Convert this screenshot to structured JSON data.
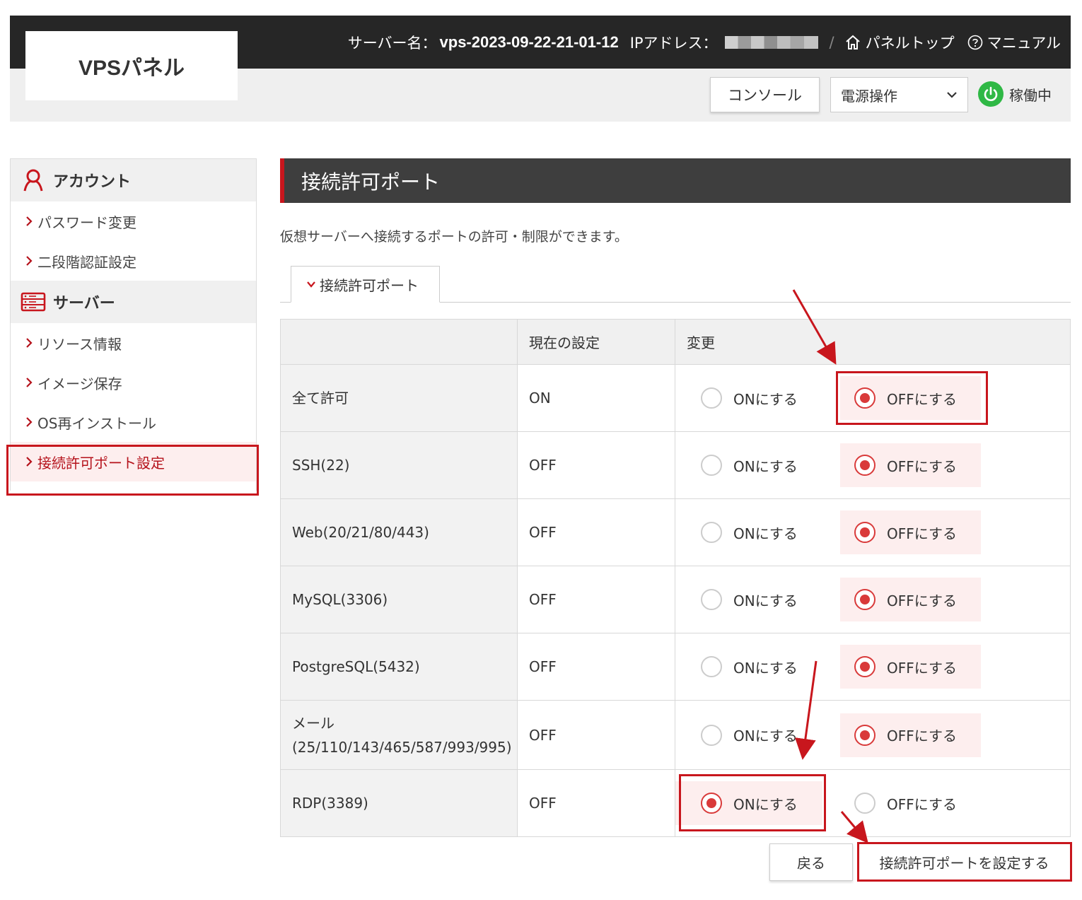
{
  "header": {
    "logo": "VPSパネル",
    "server_label": "サーバー名：",
    "server_name": "vps-2023-09-22-21-01-12",
    "ip_label": "IPアドレス：",
    "separator": "/",
    "panel_top": "パネルトップ",
    "manual": "マニュアル",
    "console_button": "コンソール",
    "power_select": "電源操作",
    "status": "稼働中"
  },
  "sidebar": {
    "account_heading": "アカウント",
    "account_items": [
      "パスワード変更",
      "二段階認証設定"
    ],
    "server_heading": "サーバー",
    "server_items": [
      "リソース情報",
      "イメージ保存",
      "OS再インストール",
      "接続許可ポート設定"
    ]
  },
  "main": {
    "title": "接続許可ポート",
    "description": "仮想サーバーへ接続するポートの許可・制限ができます。",
    "tab": "接続許可ポート",
    "table": {
      "headers": [
        "",
        "現在の設定",
        "変更"
      ],
      "on_label": "ONにする",
      "off_label": "OFFにする",
      "rows": [
        {
          "name": "全て許可",
          "current": "ON",
          "selected": "off"
        },
        {
          "name": "SSH(22)",
          "current": "OFF",
          "selected": "off"
        },
        {
          "name": "Web(20/21/80/443)",
          "current": "OFF",
          "selected": "off"
        },
        {
          "name": "MySQL(3306)",
          "current": "OFF",
          "selected": "off"
        },
        {
          "name": "PostgreSQL(5432)",
          "current": "OFF",
          "selected": "off"
        },
        {
          "name": "メール\n(25/110/143/465/587/993/995)",
          "current": "OFF",
          "selected": "off"
        },
        {
          "name": "RDP(3389)",
          "current": "OFF",
          "selected": "on"
        }
      ]
    },
    "back_button": "戻る",
    "submit_button": "接続許可ポートを設定する"
  },
  "colors": {
    "accent_red": "#c8161d",
    "header_dark": "#262626",
    "status_green": "#2fb845"
  }
}
